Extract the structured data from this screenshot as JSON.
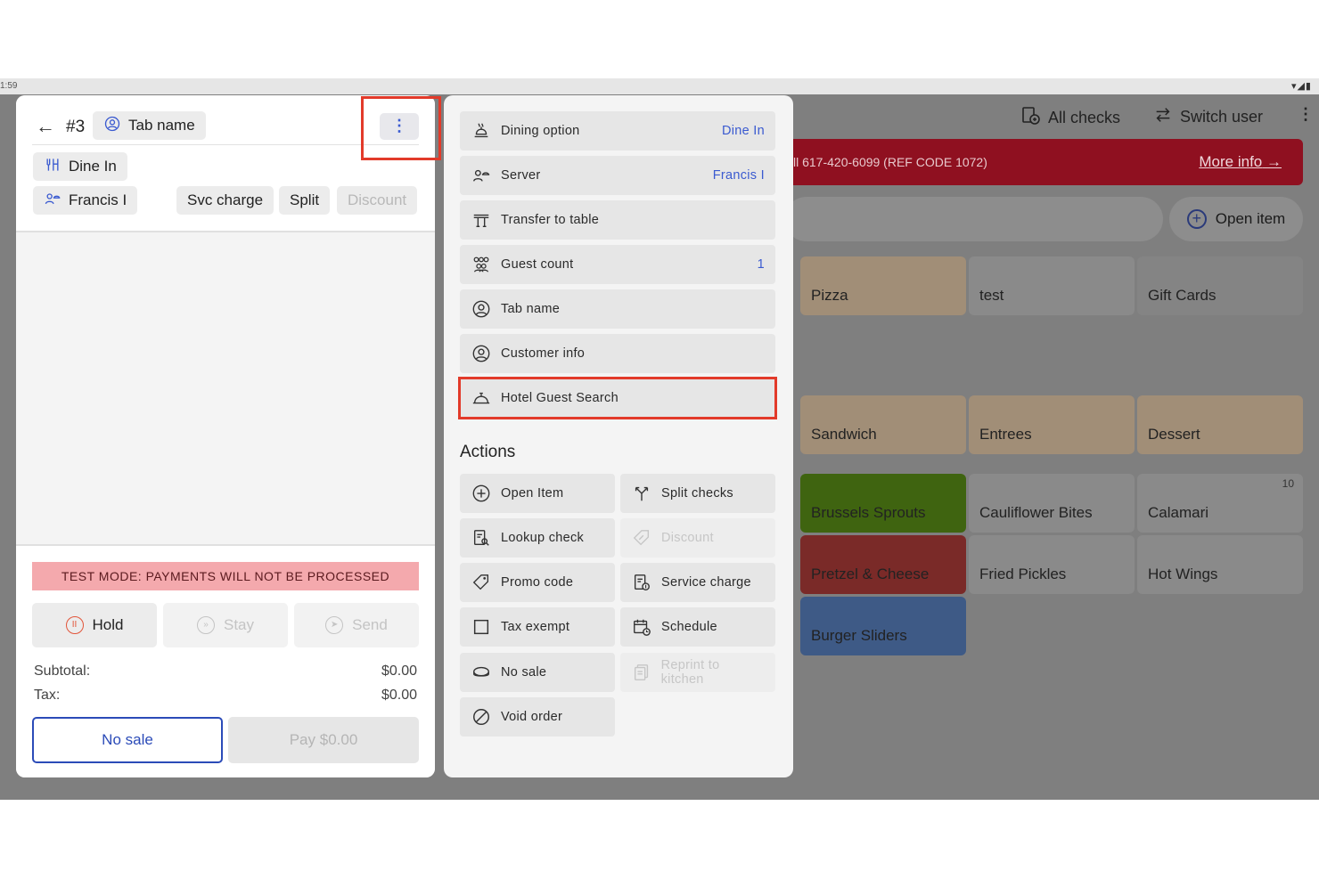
{
  "status": {
    "time": "1:59"
  },
  "header": {
    "all_checks": "All checks",
    "switch_user": "Switch user"
  },
  "banner": {
    "text": "ll 617-420-6099 (REF CODE 1072)",
    "more": "More info",
    "arrow": "→"
  },
  "open_item": "Open item",
  "categories": [
    "Pizza",
    "test",
    "Gift Cards",
    "Sandwich",
    "Entrees",
    "Dessert"
  ],
  "items": [
    {
      "label": "Brussels Sprouts",
      "color": "#3f6410"
    },
    {
      "label": "Cauliflower Bites",
      "color": "#8a8a8a"
    },
    {
      "label": "Calamari",
      "color": "#8a8a8a",
      "count": "10"
    },
    {
      "label": "Pretzel & Cheese",
      "color": "#7a2a28"
    },
    {
      "label": "Fried Pickles",
      "color": "#8a8a8a"
    },
    {
      "label": "Hot Wings",
      "color": "#8a8a8a"
    },
    {
      "label": "Burger Sliders",
      "color": "#3e5a86"
    }
  ],
  "check": {
    "number": "#3",
    "tab_name": "Tab name",
    "dining": "Dine In",
    "server": "Francis I",
    "svc_charge": "Svc charge",
    "split": "Split",
    "discount": "Discount",
    "test_mode": "TEST MODE:  PAYMENTS WILL NOT BE PROCESSED",
    "hold": "Hold",
    "stay": "Stay",
    "send": "Send",
    "subtotal_label": "Subtotal:",
    "subtotal": "$0.00",
    "tax_label": "Tax:",
    "tax": "$0.00",
    "no_sale": "No sale",
    "pay": "Pay $0.00"
  },
  "menu": {
    "rows": [
      {
        "label": "Dining option",
        "value": "Dine In"
      },
      {
        "label": "Server",
        "value": "Francis I"
      },
      {
        "label": "Transfer to table",
        "value": ""
      },
      {
        "label": "Guest count",
        "value": "1"
      },
      {
        "label": "Tab name",
        "value": ""
      },
      {
        "label": "Customer info",
        "value": ""
      },
      {
        "label": "Hotel Guest Search",
        "value": ""
      }
    ],
    "actions_title": "Actions",
    "actions": [
      {
        "label": "Open Item"
      },
      {
        "label": "Split checks"
      },
      {
        "label": "Lookup check"
      },
      {
        "label": "Discount"
      },
      {
        "label": "Promo code"
      },
      {
        "label": "Service charge"
      },
      {
        "label": "Tax exempt"
      },
      {
        "label": "Schedule"
      },
      {
        "label": "No sale"
      },
      {
        "label": "Reprint to kitchen"
      },
      {
        "label": "Void order"
      }
    ]
  },
  "colors": {
    "accent": "#3a5ad0",
    "highlight": "#e23a2a",
    "test_mode_bg": "#f4a9ad"
  }
}
